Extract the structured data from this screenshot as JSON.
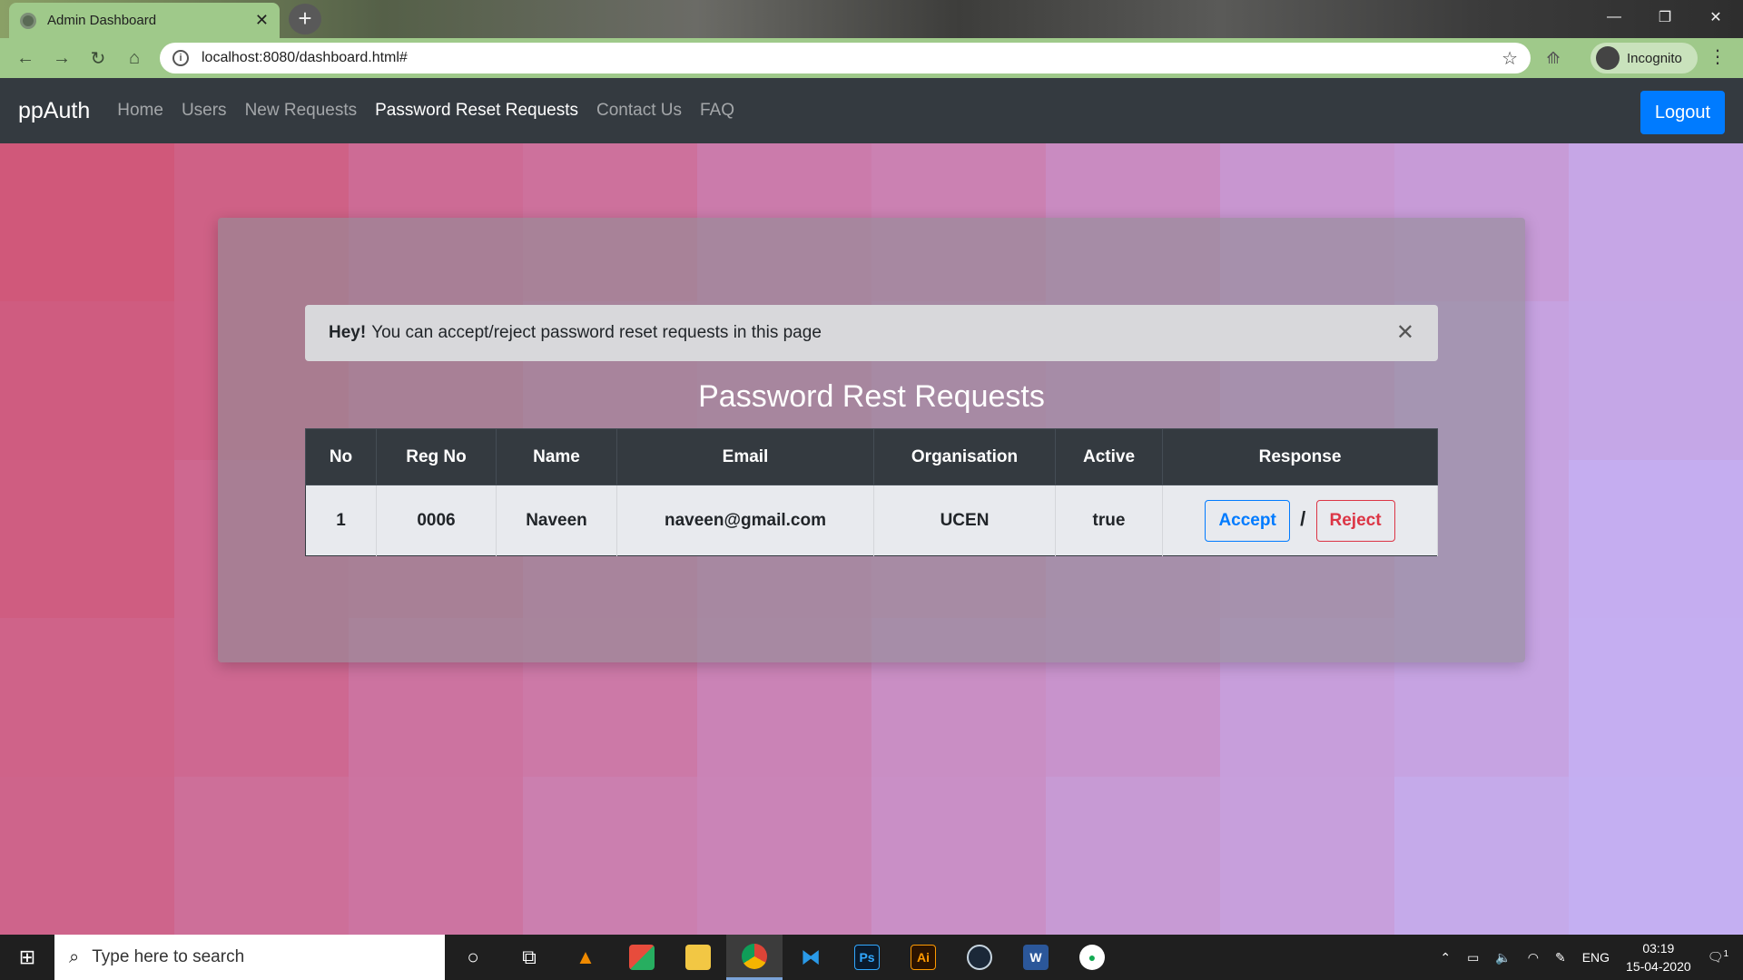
{
  "browser": {
    "tab_title": "Admin Dashboard",
    "url": "localhost:8080/dashboard.html#",
    "profile_label": "Incognito"
  },
  "navbar": {
    "brand": "ppAuth",
    "links": [
      "Home",
      "Users",
      "New Requests",
      "Password Reset Requests",
      "Contact Us",
      "FAQ"
    ],
    "active": "Password Reset Requests",
    "logout_label": "Logout"
  },
  "alert": {
    "bold": "Hey!",
    "text": "You can accept/reject password reset requests in this page"
  },
  "main": {
    "title": "Password Rest Requests",
    "table": {
      "headers": [
        "No",
        "Reg No",
        "Name",
        "Email",
        "Organisation",
        "Active",
        "Response"
      ],
      "rows": [
        {
          "no": "1",
          "reg_no": "0006",
          "name": "Naveen",
          "email": "naveen@gmail.com",
          "organisation": "UCEN",
          "active": "true",
          "accept_label": "Accept",
          "separator": "/",
          "reject_label": "Reject"
        }
      ]
    }
  },
  "taskbar": {
    "search_placeholder": "Type here to search",
    "language": "ENG",
    "time": "03:19",
    "date": "15-04-2020",
    "notification_count": "1"
  },
  "colors": {
    "navbar_bg": "#343a40",
    "primary": "#007bff",
    "danger": "#dc3545",
    "browser_accent": "#9fc98a"
  }
}
